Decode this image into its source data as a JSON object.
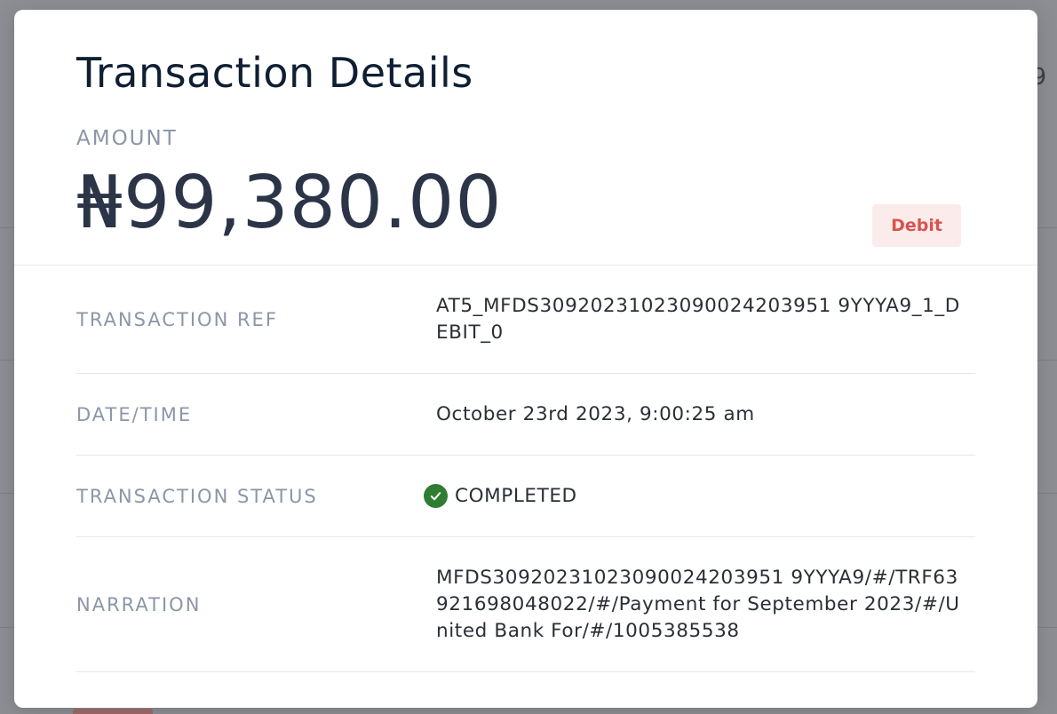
{
  "background": {
    "peek_text": "9"
  },
  "modal": {
    "title": "Transaction Details",
    "amount_label": "AMOUNT",
    "amount_value": "₦99,380.00",
    "type_badge": "Debit"
  },
  "details": {
    "rows": [
      {
        "label": "TRANSACTION REF",
        "value": "AT5_MFDS30920231023090024203951 9YYYA9_1_DEBIT_0"
      },
      {
        "label": "DATE/TIME",
        "value": "October 23rd 2023, 9:00:25 am"
      },
      {
        "label": "TRANSACTION STATUS",
        "value": "COMPLETED"
      },
      {
        "label": "NARRATION",
        "value": "MFDS30920231023090024203951 9YYYA9/#/TRF63921698048022/#/Payment for September 2023/#/United Bank For/#/1005385538"
      }
    ]
  },
  "colors": {
    "status_completed": "#2e7d32",
    "debit_text": "#d9534f",
    "debit_bg": "#fbeceb"
  },
  "icons": {
    "status": "check-circle-icon"
  }
}
